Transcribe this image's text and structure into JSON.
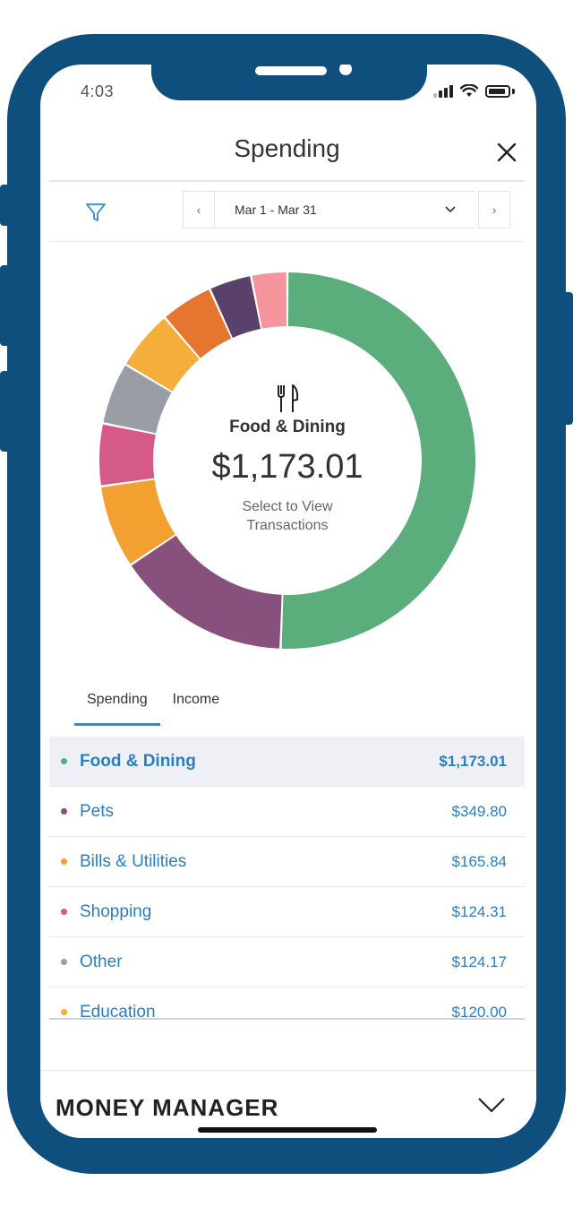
{
  "status_bar": {
    "time": "4:03"
  },
  "header": {
    "title": "Spending"
  },
  "date_nav": {
    "range": "Mar 1 - Mar 31",
    "prev": "‹",
    "next": "›",
    "dropdown": "⌄"
  },
  "center": {
    "category": "Food & Dining",
    "amount": "$1,173.01",
    "hint_line1": "Select to View",
    "hint_line2": "Transactions"
  },
  "tabs": [
    {
      "label": "Spending",
      "active": true
    },
    {
      "label": "Income",
      "active": false
    }
  ],
  "categories": [
    {
      "name": "Food & Dining",
      "amount": "$1,173.01",
      "color": "#5bad7c",
      "selected": true
    },
    {
      "name": "Pets",
      "amount": "$349.80",
      "color": "#87507d"
    },
    {
      "name": "Bills & Utilities",
      "amount": "$165.84",
      "color": "#f2a030"
    },
    {
      "name": "Shopping",
      "amount": "$124.31",
      "color": "#d65a88"
    },
    {
      "name": "Other",
      "amount": "$124.17",
      "color": "#999da6"
    },
    {
      "name": "Education",
      "amount": "$120.00",
      "color": "#f5ad3b"
    }
  ],
  "chart_data": {
    "type": "pie",
    "slices": [
      {
        "value": 1173.01,
        "color": "#5bad7c"
      },
      {
        "value": 349.8,
        "color": "#87507d"
      },
      {
        "value": 165.84,
        "color": "#f2a030"
      },
      {
        "value": 124.31,
        "color": "#d65a88"
      },
      {
        "value": 124.17,
        "color": "#999da6"
      },
      {
        "value": 120.0,
        "color": "#f5ad3b"
      },
      {
        "value": 105.0,
        "color": "#e5762f"
      },
      {
        "value": 85.0,
        "color": "#5a416c"
      },
      {
        "value": 72.0,
        "color": "#f6949e"
      }
    ]
  },
  "footer": {
    "title": "MONEY MANAGER"
  },
  "colors": {
    "accent": "#2a7fc1",
    "frame": "#0e4f7e"
  }
}
